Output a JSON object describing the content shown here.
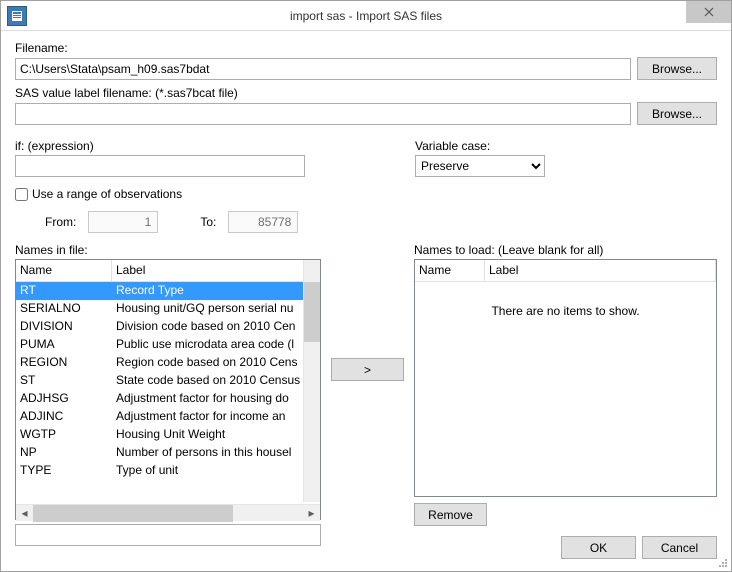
{
  "window": {
    "title": "import sas - Import SAS files"
  },
  "filename": {
    "label": "Filename:",
    "value": "C:\\Users\\Stata\\psam_h09.sas7bdat",
    "browse": "Browse..."
  },
  "valuelabel": {
    "label": "SAS value label filename: (*.sas7bcat file)",
    "value": "",
    "browse": "Browse..."
  },
  "ifexpr": {
    "label": "if: (expression)",
    "value": ""
  },
  "varcase": {
    "label": "Variable case:",
    "selected": "Preserve"
  },
  "range": {
    "checkbox_label": "Use a range of observations",
    "checked": false,
    "from_label": "From:",
    "from_value": "1",
    "to_label": "To:",
    "to_value": "85778"
  },
  "names_in_file": {
    "label": "Names in file:",
    "col_name": "Name",
    "col_label": "Label",
    "rows": [
      {
        "name": "RT",
        "label": "Record Type",
        "selected": true
      },
      {
        "name": "SERIALNO",
        "label": "Housing unit/GQ person serial nu"
      },
      {
        "name": "DIVISION",
        "label": "Division code based on 2010 Cen"
      },
      {
        "name": "PUMA",
        "label": "Public use microdata area code (l"
      },
      {
        "name": "REGION",
        "label": "Region code based on 2010 Cens"
      },
      {
        "name": "ST",
        "label": "State code based on 2010 Census"
      },
      {
        "name": "ADJHSG",
        "label": "Adjustment factor for housing do"
      },
      {
        "name": "ADJINC",
        "label": "Adjustment factor for income an"
      },
      {
        "name": "WGTP",
        "label": "Housing Unit Weight"
      },
      {
        "name": "NP",
        "label": "Number of persons in this housel"
      },
      {
        "name": "TYPE",
        "label": "Type of unit"
      }
    ],
    "filter_value": ""
  },
  "names_to_load": {
    "label": "Names to load: (Leave blank for all)",
    "col_name": "Name",
    "col_label": "Label",
    "empty_msg": "There are no items to show."
  },
  "buttons": {
    "move_right": ">",
    "remove": "Remove",
    "ok": "OK",
    "cancel": "Cancel"
  }
}
